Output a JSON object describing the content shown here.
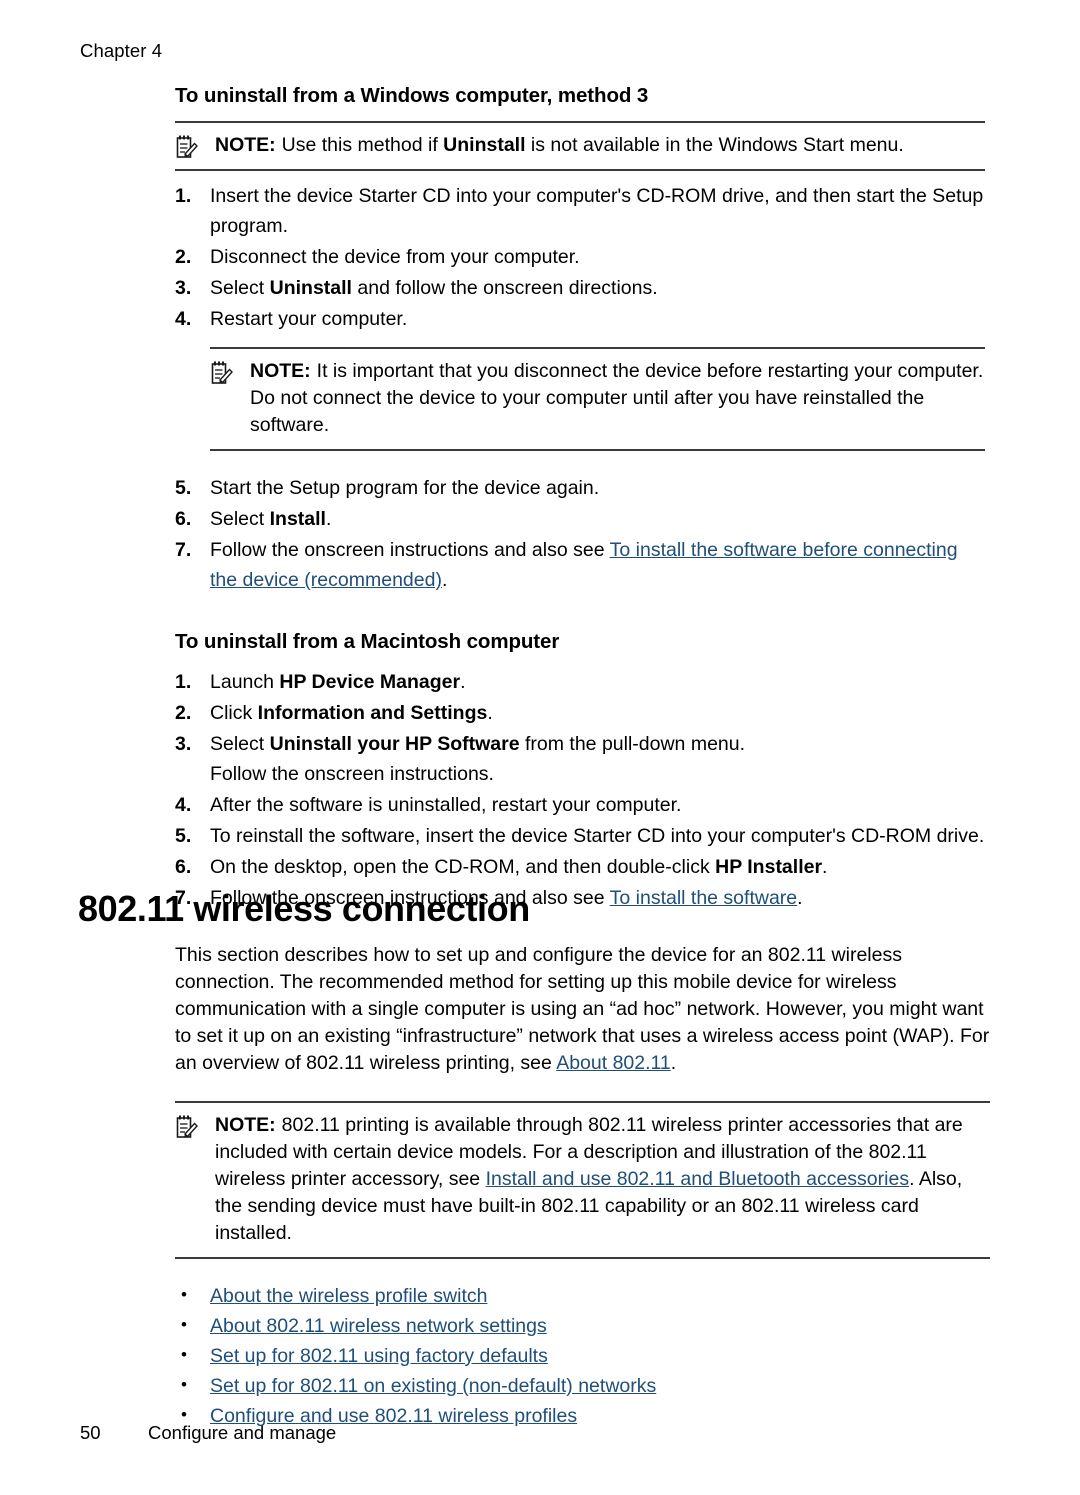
{
  "page": {
    "chapter_label": "Chapter 4",
    "footer_page_number": "50",
    "footer_section": "Configure and manage",
    "link_color": "#1f4e79",
    "rule_color": "#3c3c3c"
  },
  "windows_section": {
    "heading": "To uninstall from a Windows computer, method 3",
    "note": {
      "icon": "note-pad-pencil-icon",
      "label": "NOTE:",
      "text_before_bold": "Use this method if ",
      "bold_text": "Uninstall",
      "text_after_bold": " is not available in the Windows Start menu."
    },
    "steps": [
      {
        "num": "1.",
        "text": "Insert the device Starter CD into your computer's CD-ROM drive, and then start the Setup program."
      },
      {
        "num": "2.",
        "text": "Disconnect the device from your computer."
      },
      {
        "num": "3.",
        "pre": "Select ",
        "bold": "Uninstall",
        "post": " and follow the onscreen directions."
      },
      {
        "num": "4.",
        "text": "Restart your computer."
      }
    ],
    "inner_note": {
      "icon": "note-pad-pencil-icon",
      "label": "NOTE:",
      "text": "It is important that you disconnect the device before restarting your computer. Do not connect the device to your computer until after you have reinstalled the software."
    },
    "steps_cont": [
      {
        "num": "5.",
        "text": "Start the Setup program for the device again."
      },
      {
        "num": "6.",
        "pre": "Select ",
        "bold": "Install",
        "post": "."
      },
      {
        "num": "7.",
        "pre": "Follow the onscreen instructions and also see ",
        "link": "To install the software before connecting the device (recommended)",
        "post": "."
      }
    ]
  },
  "macintosh_section": {
    "heading": "To uninstall from a Macintosh computer",
    "steps": [
      {
        "num": "1.",
        "pre": "Launch ",
        "bold": "HP Device Manager",
        "post": "."
      },
      {
        "num": "2.",
        "pre": "Click ",
        "bold": "Information and Settings",
        "post": "."
      },
      {
        "num": "3.",
        "pre": "Select ",
        "bold": "Uninstall your HP Software",
        "post": " from the pull-down menu.",
        "second_line": "Follow the onscreen instructions."
      },
      {
        "num": "4.",
        "text": "After the software is uninstalled, restart your computer."
      },
      {
        "num": "5.",
        "text": "To reinstall the software, insert the device Starter CD into your computer's CD-ROM drive."
      },
      {
        "num": "6.",
        "pre": "On the desktop, open the CD-ROM, and then double-click ",
        "bold": "HP Installer",
        "post": "."
      },
      {
        "num": "7.",
        "pre": "Follow the onscreen instructions and also see ",
        "link": "To install the software",
        "post": "."
      }
    ]
  },
  "wireless_section": {
    "heading": "802.11 wireless connection",
    "intro_pre": "This section describes how to set up and configure the device for an 802.11 wireless connection. The recommended method for setting up this mobile device for wireless communication with a single computer is using an “ad hoc” network. However, you might want to set it up on an existing “infrastructure” network that uses a wireless access point (WAP). For an overview of 802.11 wireless printing, see ",
    "intro_link": "About 802.11",
    "intro_post": ".",
    "note": {
      "icon": "note-pad-pencil-icon",
      "label": "NOTE:",
      "pre": "802.11 printing is available through 802.11 wireless printer accessories that are included with certain device models. For a description and illustration of the 802.11 wireless printer accessory, see ",
      "link": "Install and use 802.11 and Bluetooth accessories",
      "post": ". Also, the sending device must have built-in 802.11 capability or an 802.11 wireless card installed."
    },
    "links": [
      {
        "bullet": "•",
        "label": "About the wireless profile switch"
      },
      {
        "bullet": "•",
        "label": "About 802.11 wireless network settings"
      },
      {
        "bullet": "•",
        "label": "Set up for 802.11 using factory defaults"
      },
      {
        "bullet": "•",
        "label": "Set up for 802.11 on existing (non-default) networks"
      },
      {
        "bullet": "•",
        "label": "Configure and use 802.11 wireless profiles"
      }
    ]
  }
}
